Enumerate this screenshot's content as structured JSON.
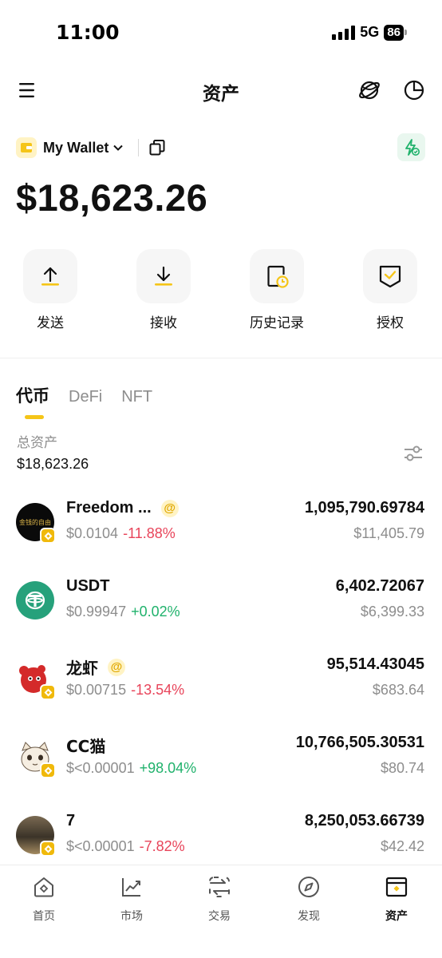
{
  "status_bar": {
    "time": "11:00",
    "network": "5G",
    "battery": "86"
  },
  "header": {
    "title": "资产"
  },
  "wallet": {
    "name": "My Wallet",
    "balance": "$18,623.26"
  },
  "actions": [
    {
      "label": "发送",
      "icon": "upload-arrow-icon"
    },
    {
      "label": "接收",
      "icon": "download-arrow-icon"
    },
    {
      "label": "历史记录",
      "icon": "history-icon"
    },
    {
      "label": "授权",
      "icon": "authorize-shield-icon"
    }
  ],
  "tabs": [
    {
      "label": "代币",
      "active": true
    },
    {
      "label": "DeFi",
      "active": false
    },
    {
      "label": "NFT",
      "active": false
    }
  ],
  "total": {
    "label": "总资产",
    "value": "$18,623.26"
  },
  "tokens": [
    {
      "name": "Freedom ...",
      "price": "$0.0104",
      "change": "-11.88%",
      "amount": "1,095,790.69784",
      "value": "$11,405.79"
    },
    {
      "name": "USDT",
      "price": "$0.99947",
      "change": "+0.02%",
      "amount": "6,402.72067",
      "value": "$6,399.33"
    },
    {
      "name": "龙虾",
      "price": "$0.00715",
      "change": "-13.54%",
      "amount": "95,514.43045",
      "value": "$683.64"
    },
    {
      "name": "CC猫",
      "price": "$<0.00001",
      "change": "+98.04%",
      "amount": "10,766,505.30531",
      "value": "$80.74"
    },
    {
      "name": "7",
      "price": "$<0.00001",
      "change": "-7.82%",
      "amount": "8,250,053.66739",
      "value": "$42.42"
    }
  ],
  "token_badges": {
    "at_symbol": "@",
    "freedom_logo_text": "金钱的自由"
  },
  "colors": {
    "accent": "#f5c518",
    "down": "#e8445a",
    "up": "#20b26c",
    "chain_badge": "#f0b90b",
    "usdt": "#26a17b"
  },
  "bottom_nav": [
    {
      "label": "首页",
      "icon": "home-icon"
    },
    {
      "label": "市场",
      "icon": "market-chart-icon"
    },
    {
      "label": "交易",
      "icon": "swap-icon"
    },
    {
      "label": "发现",
      "icon": "discover-compass-icon"
    },
    {
      "label": "资产",
      "icon": "wallet-icon",
      "active": true
    }
  ]
}
